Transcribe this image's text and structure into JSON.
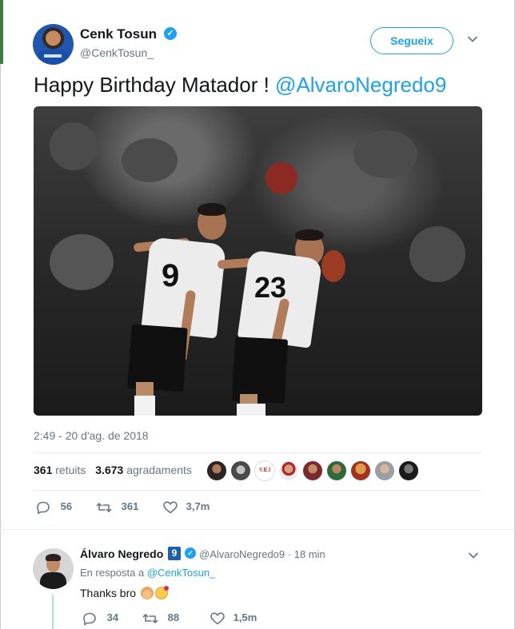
{
  "tweet": {
    "author_name": "Cenk Tosun",
    "author_handle": "@CenkTosun_",
    "follow_label": "Segueix",
    "text": "Happy Birthday Matador ! ",
    "mention": "@AlvaroNegredo9",
    "photo_player_numbers": [
      "9",
      "23"
    ],
    "timestamp": "2:49 - 20 d'ag. de 2018",
    "retweets_count": "361",
    "retweets_label": "retuits",
    "likes_count": "3.673",
    "likes_label": "agradaments",
    "actions": {
      "replies": "56",
      "retweets": "361",
      "likes": "3,7m"
    },
    "liker_avatar_badge": "Y.E.İ"
  },
  "reply": {
    "author_name": "Álvaro Negredo",
    "name_badge": "9",
    "author_handle": "@AlvaroNegredo9",
    "separator": "·",
    "time": "18 min",
    "reply_prefix": "En resposta a ",
    "reply_to": "@CenkTosun_",
    "text": "Thanks bro",
    "emojis": [
      "folded-hands-emoji",
      "face-blowing-kiss-emoji"
    ],
    "actions": {
      "replies": "34",
      "retweets": "88",
      "likes": "1,5m"
    }
  },
  "colors": {
    "accent": "#1da1f2",
    "secondary_text": "#657786",
    "primary_text": "#14171a",
    "divider": "#e6ecf0",
    "thread_line": "#a8ddf7"
  }
}
